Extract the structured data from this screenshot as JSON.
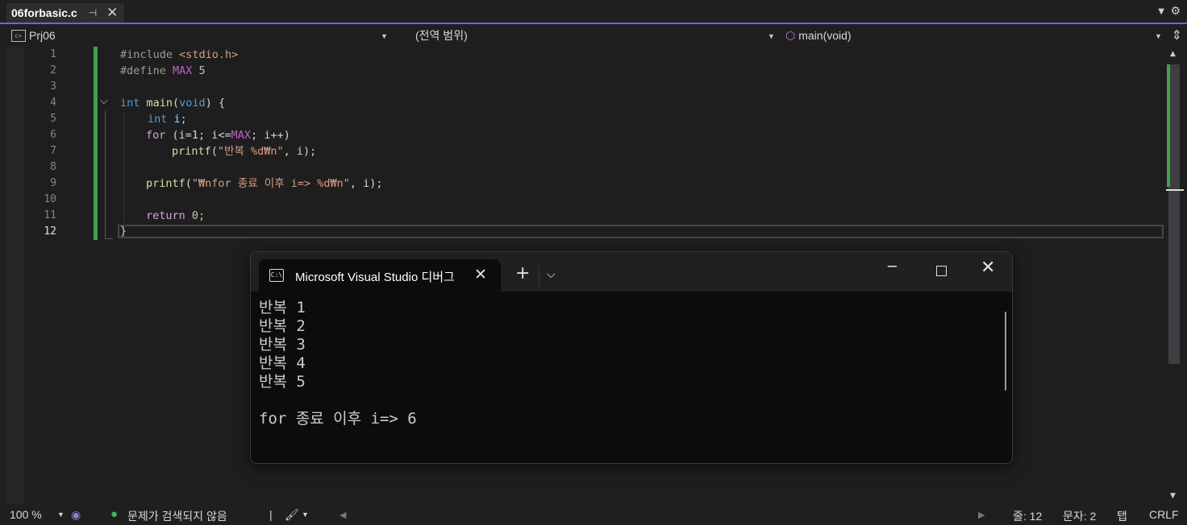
{
  "tabs": {
    "active_file": "06forbasic.c",
    "pin_icon": "pin-icon",
    "close_glyph": "✕"
  },
  "navbar": {
    "project": "Prj06",
    "scope": "(전역 범위)",
    "member": "main(void)"
  },
  "editor": {
    "line_numbers": [
      "1",
      "2",
      "3",
      "4",
      "5",
      "6",
      "7",
      "8",
      "9",
      "10",
      "11",
      "12"
    ],
    "current_line": 12,
    "code": {
      "l1_pp": "#include ",
      "l1_hdr": "<stdio.h>",
      "l2_pp": "#define ",
      "l2_macro": "MAX",
      "l2_val": " 5",
      "l4_kw": "int",
      "l4_fn": " main",
      "l4_open": "(",
      "l4_void": "void",
      "l4_close": ") {",
      "l5_kw": "int",
      "l5_var": " i;",
      "l6_for": "for",
      "l6_a": " (i=1; i<=",
      "l6_macro": "MAX",
      "l6_b": "; i++)",
      "l7_fn": "printf",
      "l7_open": "(",
      "l7_str": "\"반복 %d₩n\"",
      "l7_close": ", i);",
      "l9_fn": "printf",
      "l9_open": "(",
      "l9_str": "\"₩nfor 종료 이후 i=> %d₩n\"",
      "l9_close": ", i);",
      "l11_ret": "return",
      "l11_rest": " 0;",
      "l12": "}"
    }
  },
  "console": {
    "title": "Microsoft Visual Studio 디버그",
    "output": "반복 1\n반복 2\n반복 3\n반복 4\n반복 5\n\nfor 종료 이후 i=> 6"
  },
  "statusbar": {
    "zoom": "100 %",
    "issues": "문제가 검색되지 않음",
    "line": "줄: 12",
    "col": "문자: 2",
    "indent": "탭",
    "eol": "CRLF"
  },
  "colors": {
    "accent": "#7160e8",
    "change_bar": "#3fa34d",
    "keyword": "#569cd6",
    "string": "#d69d85"
  }
}
